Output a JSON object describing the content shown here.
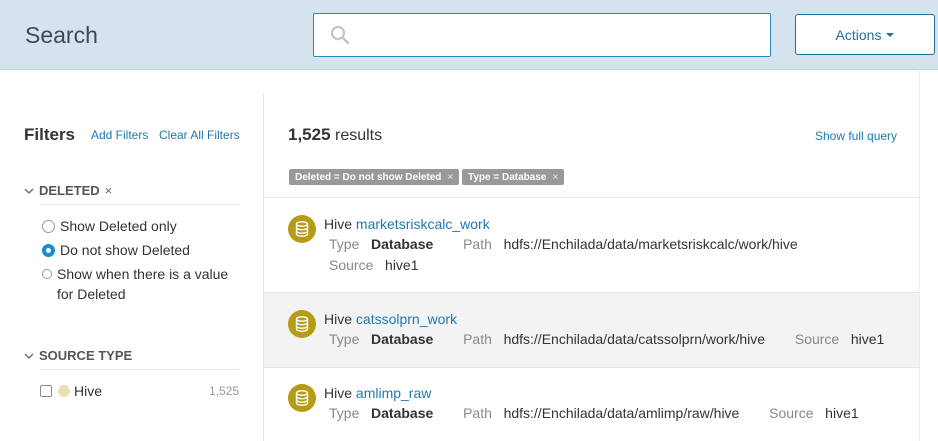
{
  "header": {
    "title": "Search",
    "search_placeholder": "",
    "actions_label": "Actions"
  },
  "sidebar": {
    "filters_title": "Filters",
    "add_filters": "Add Filters",
    "clear_all_filters": "Clear All Filters",
    "deleted_facet": {
      "title": "DELETED",
      "remove": "×",
      "options": [
        {
          "label": "Show Deleted only",
          "checked": false
        },
        {
          "label": "Do not show Deleted",
          "checked": true
        },
        {
          "label_line1": "Show when there is a value",
          "label_line2": "for Deleted",
          "checked": false
        }
      ]
    },
    "source_type_facet": {
      "title": "SOURCE TYPE",
      "items": [
        {
          "label": "Hive",
          "count": "1,525",
          "color": "#ebe1b8"
        }
      ]
    }
  },
  "results": {
    "count": "1,525",
    "count_suffix": "results",
    "show_full_query": "Show full query",
    "chips": [
      {
        "label": "Deleted = Do not show Deleted",
        "remove": "×"
      },
      {
        "label": "Type = Database",
        "remove": "×"
      }
    ],
    "items": [
      {
        "prefix": "Hive",
        "name": "marketsriskcalc_work",
        "type_label": "Type",
        "type": "Database",
        "path_label": "Path",
        "path": "hdfs://Enchilada/data/marketsriskcalc/work/hive",
        "source_label": "Source",
        "source": "hive1"
      },
      {
        "prefix": "Hive",
        "name": "catssolprn_work",
        "type_label": "Type",
        "type": "Database",
        "path_label": "Path",
        "path": "hdfs://Enchilada/data/catssolprn/work/hive",
        "source_label": "Source",
        "source": "hive1"
      },
      {
        "prefix": "Hive",
        "name": "amlimp_raw",
        "type_label": "Type",
        "type": "Database",
        "path_label": "Path",
        "path": "hdfs://Enchilada/data/amlimp/raw/hive",
        "source_label": "Source",
        "source": "hive1"
      }
    ]
  },
  "colors": {
    "header_bg": "#d4e3ee",
    "link": "#1d7ab0",
    "database_icon": "#b59b16",
    "chip_bg": "#999999"
  }
}
